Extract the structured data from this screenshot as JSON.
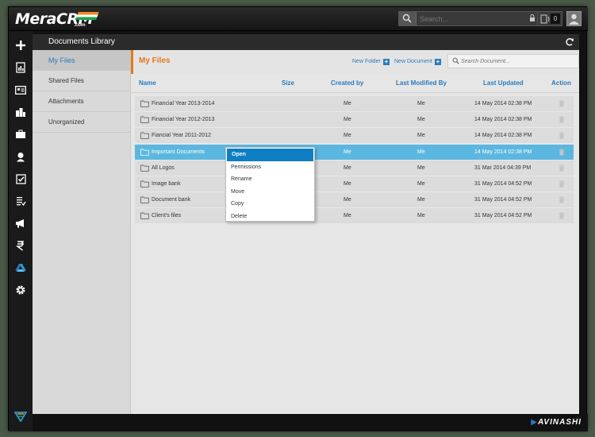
{
  "app": {
    "logo_mera": "Mera",
    "logo_crm": "CRM",
    "logo_dotcom": ".com",
    "brand": "AVINASHI"
  },
  "topbar": {
    "search_placeholder": "Search...",
    "notification_count": "0"
  },
  "panel": {
    "title": "Documents Library"
  },
  "library_nav": [
    {
      "label": "My Files",
      "active": true
    },
    {
      "label": "Shared Files",
      "active": false
    },
    {
      "label": "Attachments",
      "active": false
    },
    {
      "label": "Unorganized",
      "active": false
    }
  ],
  "content": {
    "title": "My Files",
    "new_folder": "New Folder",
    "new_document": "New Document",
    "search_placeholder": "Search Document..."
  },
  "table": {
    "columns": [
      "Name",
      "Size",
      "Created by",
      "Last Modified By",
      "Last Updated",
      "Action"
    ],
    "rows": [
      {
        "name": "Financial Year 2013-2014",
        "size": "",
        "created_by": "Me",
        "modified_by": "Me",
        "updated": "14 May 2014 02:38 PM"
      },
      {
        "name": "Financial Year 2012-2013",
        "size": "",
        "created_by": "Me",
        "modified_by": "Me",
        "updated": "14 May 2014 02:38 PM"
      },
      {
        "name": "Fiancial Year 2011-2012",
        "size": "",
        "created_by": "Me",
        "modified_by": "Me",
        "updated": "14 May 2014 02:38 PM"
      },
      {
        "name": "Important Documents",
        "size": "",
        "created_by": "Me",
        "modified_by": "Me",
        "updated": "14 May 2014 02:38 PM"
      },
      {
        "name": "All Logos",
        "size": "",
        "created_by": "Me",
        "modified_by": "Me",
        "updated": "31 Mar 2014 04:39 PM"
      },
      {
        "name": "Image bank",
        "size": "",
        "created_by": "Me",
        "modified_by": "Me",
        "updated": "31 May 2014 04:52 PM"
      },
      {
        "name": "Document bank",
        "size": "",
        "created_by": "Me",
        "modified_by": "Me",
        "updated": "31 May 2014 04:52 PM"
      },
      {
        "name": "Client's files",
        "size": "",
        "created_by": "Me",
        "modified_by": "Me",
        "updated": "31 May 2014 04:52 PM"
      }
    ],
    "selected_row": 3
  },
  "context_menu": {
    "items": [
      "Open",
      "Permissions",
      "Rename",
      "Move",
      "Copy",
      "Delete"
    ],
    "active": 0
  },
  "colors": {
    "accent_orange": "#e4781e",
    "link_blue": "#2a7bbd",
    "selected_row": "#5bb7df",
    "menu_active": "#0d7fc2"
  },
  "rail_icons": [
    "plus-icon",
    "report-icon",
    "contact-card-icon",
    "building-icon",
    "briefcase-icon",
    "person-icon",
    "checkbox-icon",
    "list-check-icon",
    "megaphone-icon",
    "rupee-icon",
    "drive-icon",
    "gear-icon"
  ]
}
